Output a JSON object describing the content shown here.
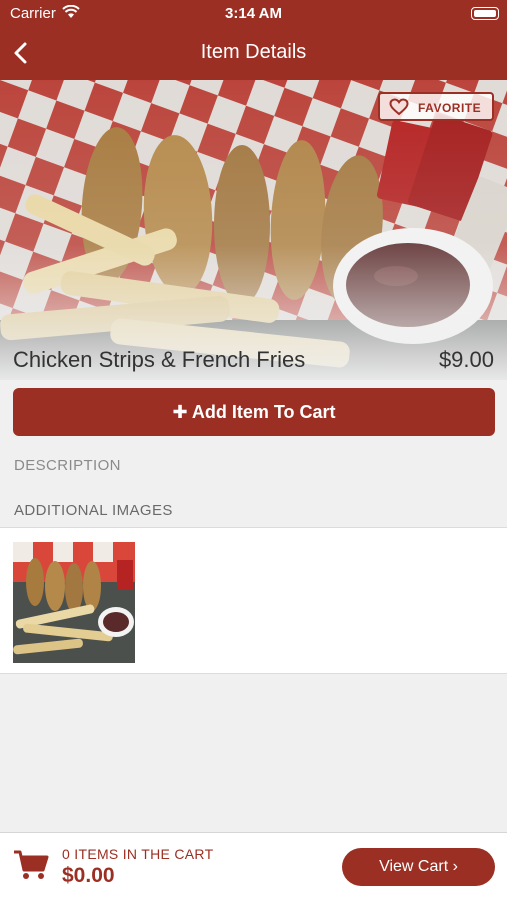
{
  "status_bar": {
    "carrier": "Carrier",
    "time": "3:14 AM"
  },
  "nav": {
    "title": "Item Details"
  },
  "item": {
    "name": "Chicken Strips & French Fries",
    "price": "$9.00",
    "favorite_label": "FAVORITE",
    "add_to_cart_label": "Add Item To Cart"
  },
  "sections": {
    "description_label": "DESCRIPTION",
    "additional_images_label": "ADDITIONAL IMAGES"
  },
  "cart": {
    "items_label": "0 ITEMS IN THE CART",
    "total": "$0.00",
    "view_cart_label": "View Cart"
  },
  "colors": {
    "brand": "#9b2f23",
    "text": "#333333",
    "muted": "#8a8a8a"
  }
}
